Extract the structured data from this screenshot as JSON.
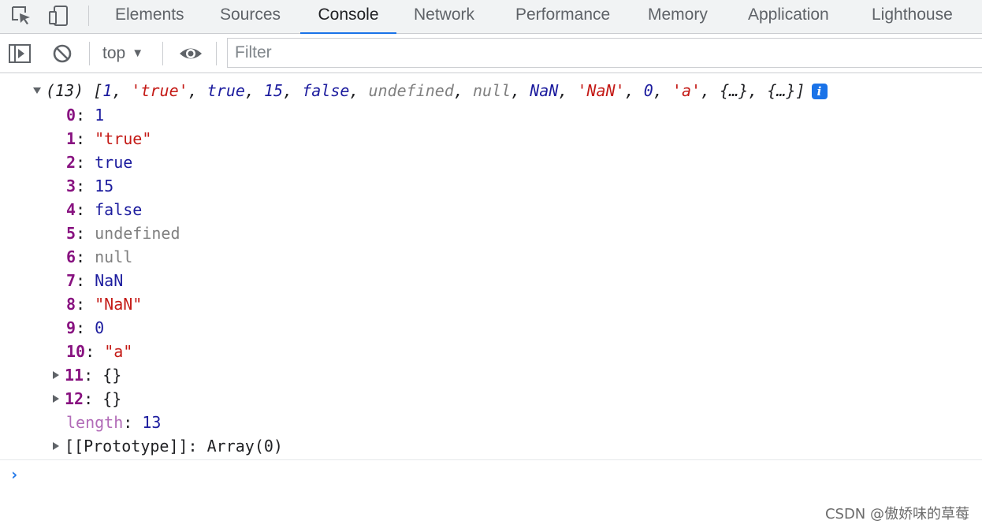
{
  "tabs": [
    {
      "label": "Elements",
      "active": false
    },
    {
      "label": "Sources",
      "active": false
    },
    {
      "label": "Console",
      "active": true
    },
    {
      "label": "Network",
      "active": false
    },
    {
      "label": "Performance",
      "active": false
    },
    {
      "label": "Memory",
      "active": false
    },
    {
      "label": "Application",
      "active": false
    },
    {
      "label": "Lighthouse",
      "active": false
    }
  ],
  "toolbar": {
    "context": "top",
    "filter_placeholder": "Filter"
  },
  "icons": {
    "inspect": "inspect-element-icon",
    "device": "device-toolbar-icon",
    "sidebar": "show-sidebar-icon",
    "clear": "clear-console-icon",
    "eye": "live-expression-icon",
    "info": "info-icon"
  },
  "colors": {
    "accent": "#1a73e8",
    "key": "#881280",
    "string": "#c41a16",
    "number": "#1c1c9e",
    "nullish": "#808080"
  },
  "console": {
    "summary": {
      "count": "(13)",
      "open": "[",
      "v0": "1",
      "v1": "'true'",
      "v2": "true",
      "v3": "15",
      "v4": "false",
      "v5": "undefined",
      "v6": "null",
      "v7": "NaN",
      "v8": "'NaN'",
      "v9": "0",
      "v10": "'a'",
      "v11": "{…}",
      "v12": "{…}",
      "close": "]",
      "sep": ", "
    },
    "props": [
      {
        "key": "0",
        "value": "1"
      },
      {
        "key": "1",
        "value": "\"true\""
      },
      {
        "key": "2",
        "value": "true"
      },
      {
        "key": "3",
        "value": "15"
      },
      {
        "key": "4",
        "value": "false"
      },
      {
        "key": "5",
        "value": "undefined"
      },
      {
        "key": "6",
        "value": "null"
      },
      {
        "key": "7",
        "value": "NaN"
      },
      {
        "key": "8",
        "value": "\"NaN\""
      },
      {
        "key": "9",
        "value": "0"
      },
      {
        "key": "10",
        "value": "\"a\""
      },
      {
        "key": "11",
        "value": "{}"
      },
      {
        "key": "12",
        "value": "{}"
      }
    ],
    "length": {
      "key": "length",
      "value": "13"
    },
    "prototype": {
      "key": "[[Prototype]]",
      "value": "Array(0)"
    },
    "colon": ": ",
    "prompt": "›"
  },
  "watermark": "CSDN @傲娇味的草莓"
}
